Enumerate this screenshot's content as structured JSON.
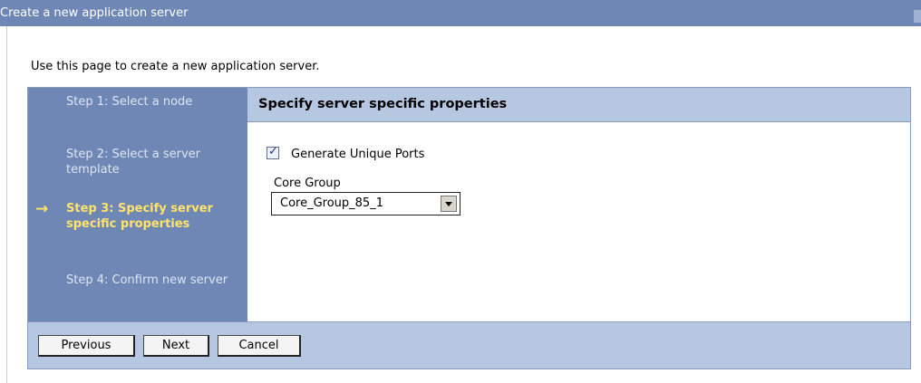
{
  "window": {
    "title": "Create a new application server"
  },
  "intro_text": "Use this page to create a new application server.",
  "steps": [
    {
      "label": "Step 1: Select a node",
      "current": false
    },
    {
      "label": "Step 2: Select a server template",
      "current": false
    },
    {
      "label": "Step 3: Specify server specific properties",
      "current": true
    },
    {
      "label": "Step 4: Confirm new server",
      "current": false
    }
  ],
  "step_marker": "→",
  "panel": {
    "heading": "Specify server specific properties",
    "generate_ports": {
      "label": "Generate Unique Ports",
      "checked": true,
      "mark": "✓"
    },
    "core_group": {
      "label": "Core Group",
      "selected": "Core_Group_85_1"
    }
  },
  "buttons": {
    "previous": "Previous",
    "next": "Next",
    "cancel": "Cancel"
  },
  "colors": {
    "steps_bg": "#6f87b5",
    "header_bg": "#b6c7e1",
    "current_step": "#ffe36a"
  }
}
